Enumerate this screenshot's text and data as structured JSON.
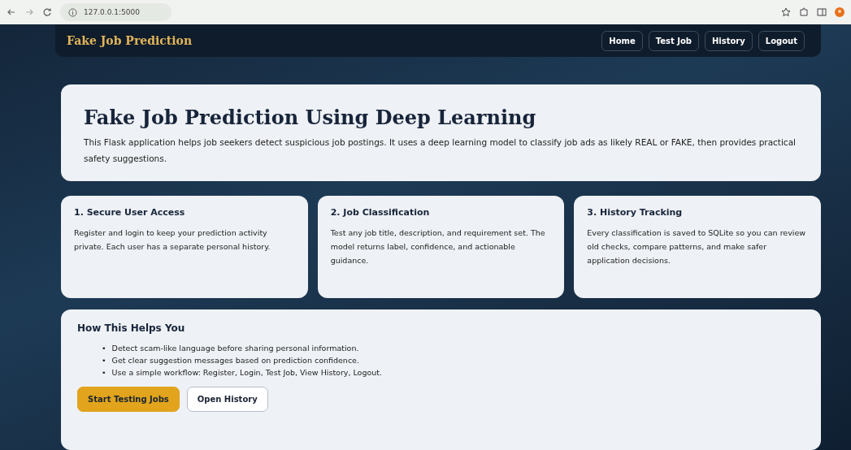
{
  "browser": {
    "url": "127.0.0.1:5000"
  },
  "navbar": {
    "brand": "Fake Job Prediction",
    "links": [
      {
        "label": "Home"
      },
      {
        "label": "Test Job"
      },
      {
        "label": "History"
      },
      {
        "label": "Logout"
      }
    ]
  },
  "hero": {
    "title": "Fake Job Prediction Using Deep Learning",
    "text": "This Flask application helps job seekers detect suspicious job postings. It uses a deep learning model to classify job ads as likely REAL or FAKE, then provides practical safety suggestions."
  },
  "features": [
    {
      "title": "1. Secure User Access",
      "text": "Register and login to keep your prediction activity private. Each user has a separate personal history."
    },
    {
      "title": "2. Job Classification",
      "text": "Test any job title, description, and requirement set. The model returns label, confidence, and actionable guidance."
    },
    {
      "title": "3. History Tracking",
      "text": "Every classification is saved to SQLite so you can review old checks, compare patterns, and make safer application decisions."
    }
  ],
  "helps": {
    "title": "How This Helps You",
    "items": [
      {
        "bullet": "•",
        "text": "Detect scam-like language before sharing personal information."
      },
      {
        "bullet": "•",
        "text": "Get clear suggestion messages based on prediction confidence."
      },
      {
        "bullet": "•",
        "text": "Use a simple workflow: Register, Login, Test Job, View History, Logout."
      }
    ],
    "buttons": [
      {
        "label": "Start Testing Jobs",
        "kind": "primary"
      },
      {
        "label": "Open History",
        "kind": "secondary"
      }
    ]
  }
}
